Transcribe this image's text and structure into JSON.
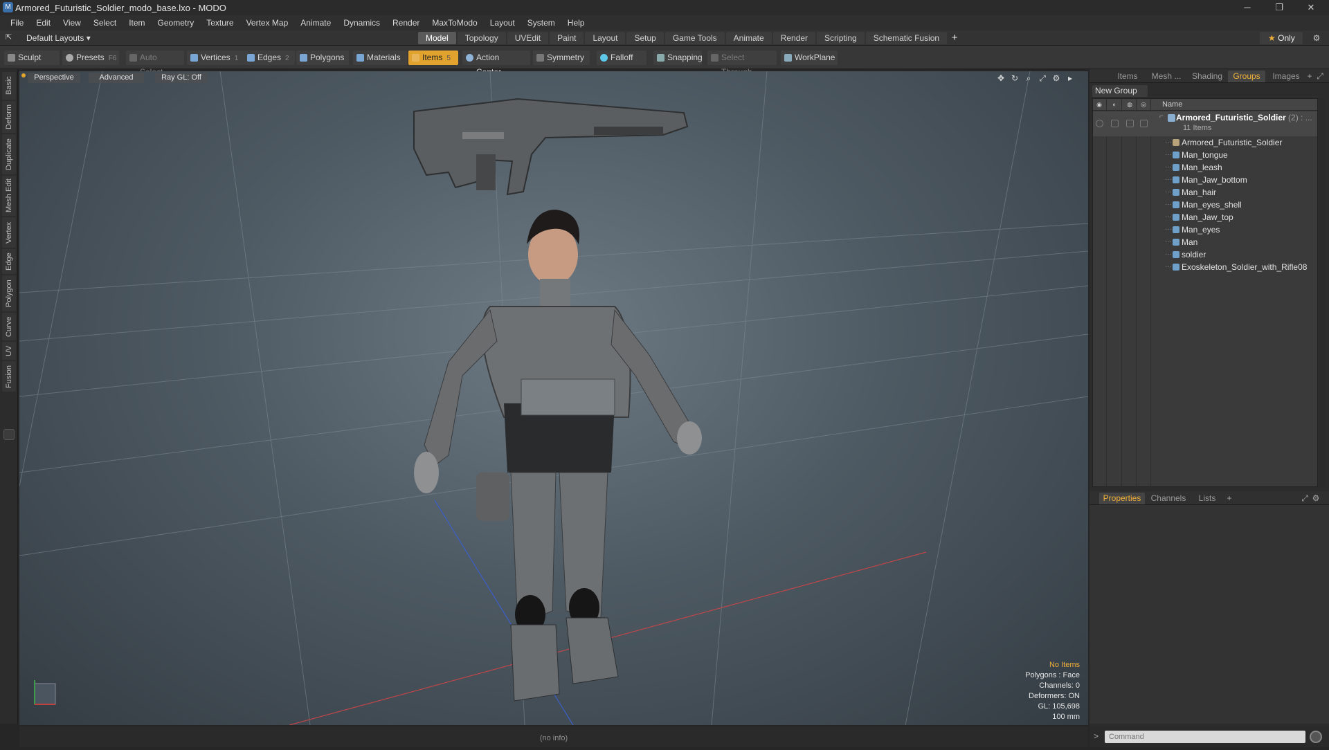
{
  "window": {
    "title": "Armored_Futuristic_Soldier_modo_base.lxo - MODO"
  },
  "menu": [
    "File",
    "Edit",
    "View",
    "Select",
    "Item",
    "Geometry",
    "Texture",
    "Vertex Map",
    "Animate",
    "Dynamics",
    "Render",
    "MaxToModo",
    "Layout",
    "System",
    "Help"
  ],
  "layout": {
    "default_layouts": "Default Layouts ▾",
    "tabs": [
      "Model",
      "Topology",
      "UVEdit",
      "Paint",
      "Layout",
      "Setup",
      "Game Tools",
      "Animate",
      "Render",
      "Scripting",
      "Schematic Fusion"
    ],
    "active_tab": "Model",
    "only_label": "Only"
  },
  "toolbar": {
    "sculpt": "Sculpt",
    "presets": "Presets",
    "presets_key": "F6",
    "auto_select": "Auto Select",
    "vertices": "Vertices",
    "vertices_key": "1",
    "edges": "Edges",
    "edges_key": "2",
    "polygons": "Polygons",
    "materials": "Materials",
    "items": "Items",
    "items_key": "5",
    "action_center": "Action Center",
    "symmetry": "Symmetry",
    "falloff": "Falloff",
    "snapping": "Snapping",
    "select_through": "Select Through",
    "workplane": "WorkPlane"
  },
  "left_tabs": [
    "Basic",
    "Deform",
    "Duplicate",
    "Mesh Edit",
    "Vertex",
    "Edge",
    "Polygon",
    "Curve",
    "UV",
    "Fusion"
  ],
  "viewport": {
    "perspective": "Perspective",
    "advanced": "Advanced",
    "raygl": "Ray GL: Off",
    "info": {
      "no_items": "No Items",
      "polygons": "Polygons : Face",
      "channels": "Channels: 0",
      "deformers": "Deformers: ON",
      "gl": "GL: 105,698",
      "scale": "100 mm"
    }
  },
  "status": {
    "text": "(no info)"
  },
  "right_panel": {
    "tabs": [
      "Items",
      "Mesh ...",
      "Shading",
      "Groups",
      "Images"
    ],
    "active_tab": "Groups",
    "new_group": "New Group",
    "column_name": "Name",
    "group": {
      "name": "Armored_Futuristic_Soldier",
      "count": "(2) : ...",
      "sub": "11 Items"
    },
    "items": [
      "Armored_Futuristic_Soldier",
      "Man_tongue",
      "Man_leash",
      "Man_Jaw_bottom",
      "Man_hair",
      "Man_eyes_shell",
      "Man_Jaw_top",
      "Man_eyes",
      "Man",
      "soldier",
      "Exoskeleton_Soldier_with_Rifle08"
    ]
  },
  "properties": {
    "tabs": [
      "Properties",
      "Channels",
      "Lists"
    ],
    "active_tab": "Properties"
  },
  "command": {
    "placeholder": "Command"
  },
  "colors": {
    "accent": "#e2a32e",
    "highlight_text": "#f0b03a"
  }
}
